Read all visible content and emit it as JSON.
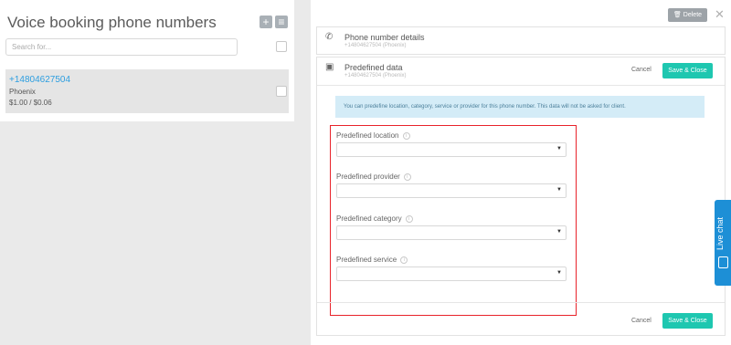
{
  "left": {
    "title": "Voice booking phone numbers",
    "add_icon": "+",
    "menu_icon": "≡",
    "search_placeholder": "Search for...",
    "items": [
      {
        "number": "+14804627504",
        "city": "Phoenix",
        "price": "$1.00 / $0.06"
      }
    ]
  },
  "right": {
    "delete_label": "Delete",
    "close_glyph": "✕",
    "phone_card": {
      "title": "Phone number details",
      "subtitle": "+14804627504 (Phoenix)"
    },
    "predefined_card": {
      "title": "Predefined data",
      "subtitle": "+14804627504 (Phoenix)",
      "cancel_label": "Cancel",
      "save_label": "Save & Close",
      "info_text": "You can predefine location, category, service or provider for this phone number. This data will not be asked for client.",
      "fields": [
        {
          "label": "Predefined location",
          "value": ""
        },
        {
          "label": "Predefined provider",
          "value": ""
        },
        {
          "label": "Predefined category",
          "value": ""
        },
        {
          "label": "Predefined service",
          "value": ""
        }
      ],
      "footer_cancel_label": "Cancel",
      "footer_save_label": "Save & Close"
    }
  },
  "live_chat": {
    "label": "Live chat"
  },
  "colors": {
    "accent": "#1ec7b0",
    "link": "#2d9ee0",
    "info_bg": "#d4ecf7",
    "highlight": "#e8232a",
    "live_chat": "#1d8fd6"
  }
}
